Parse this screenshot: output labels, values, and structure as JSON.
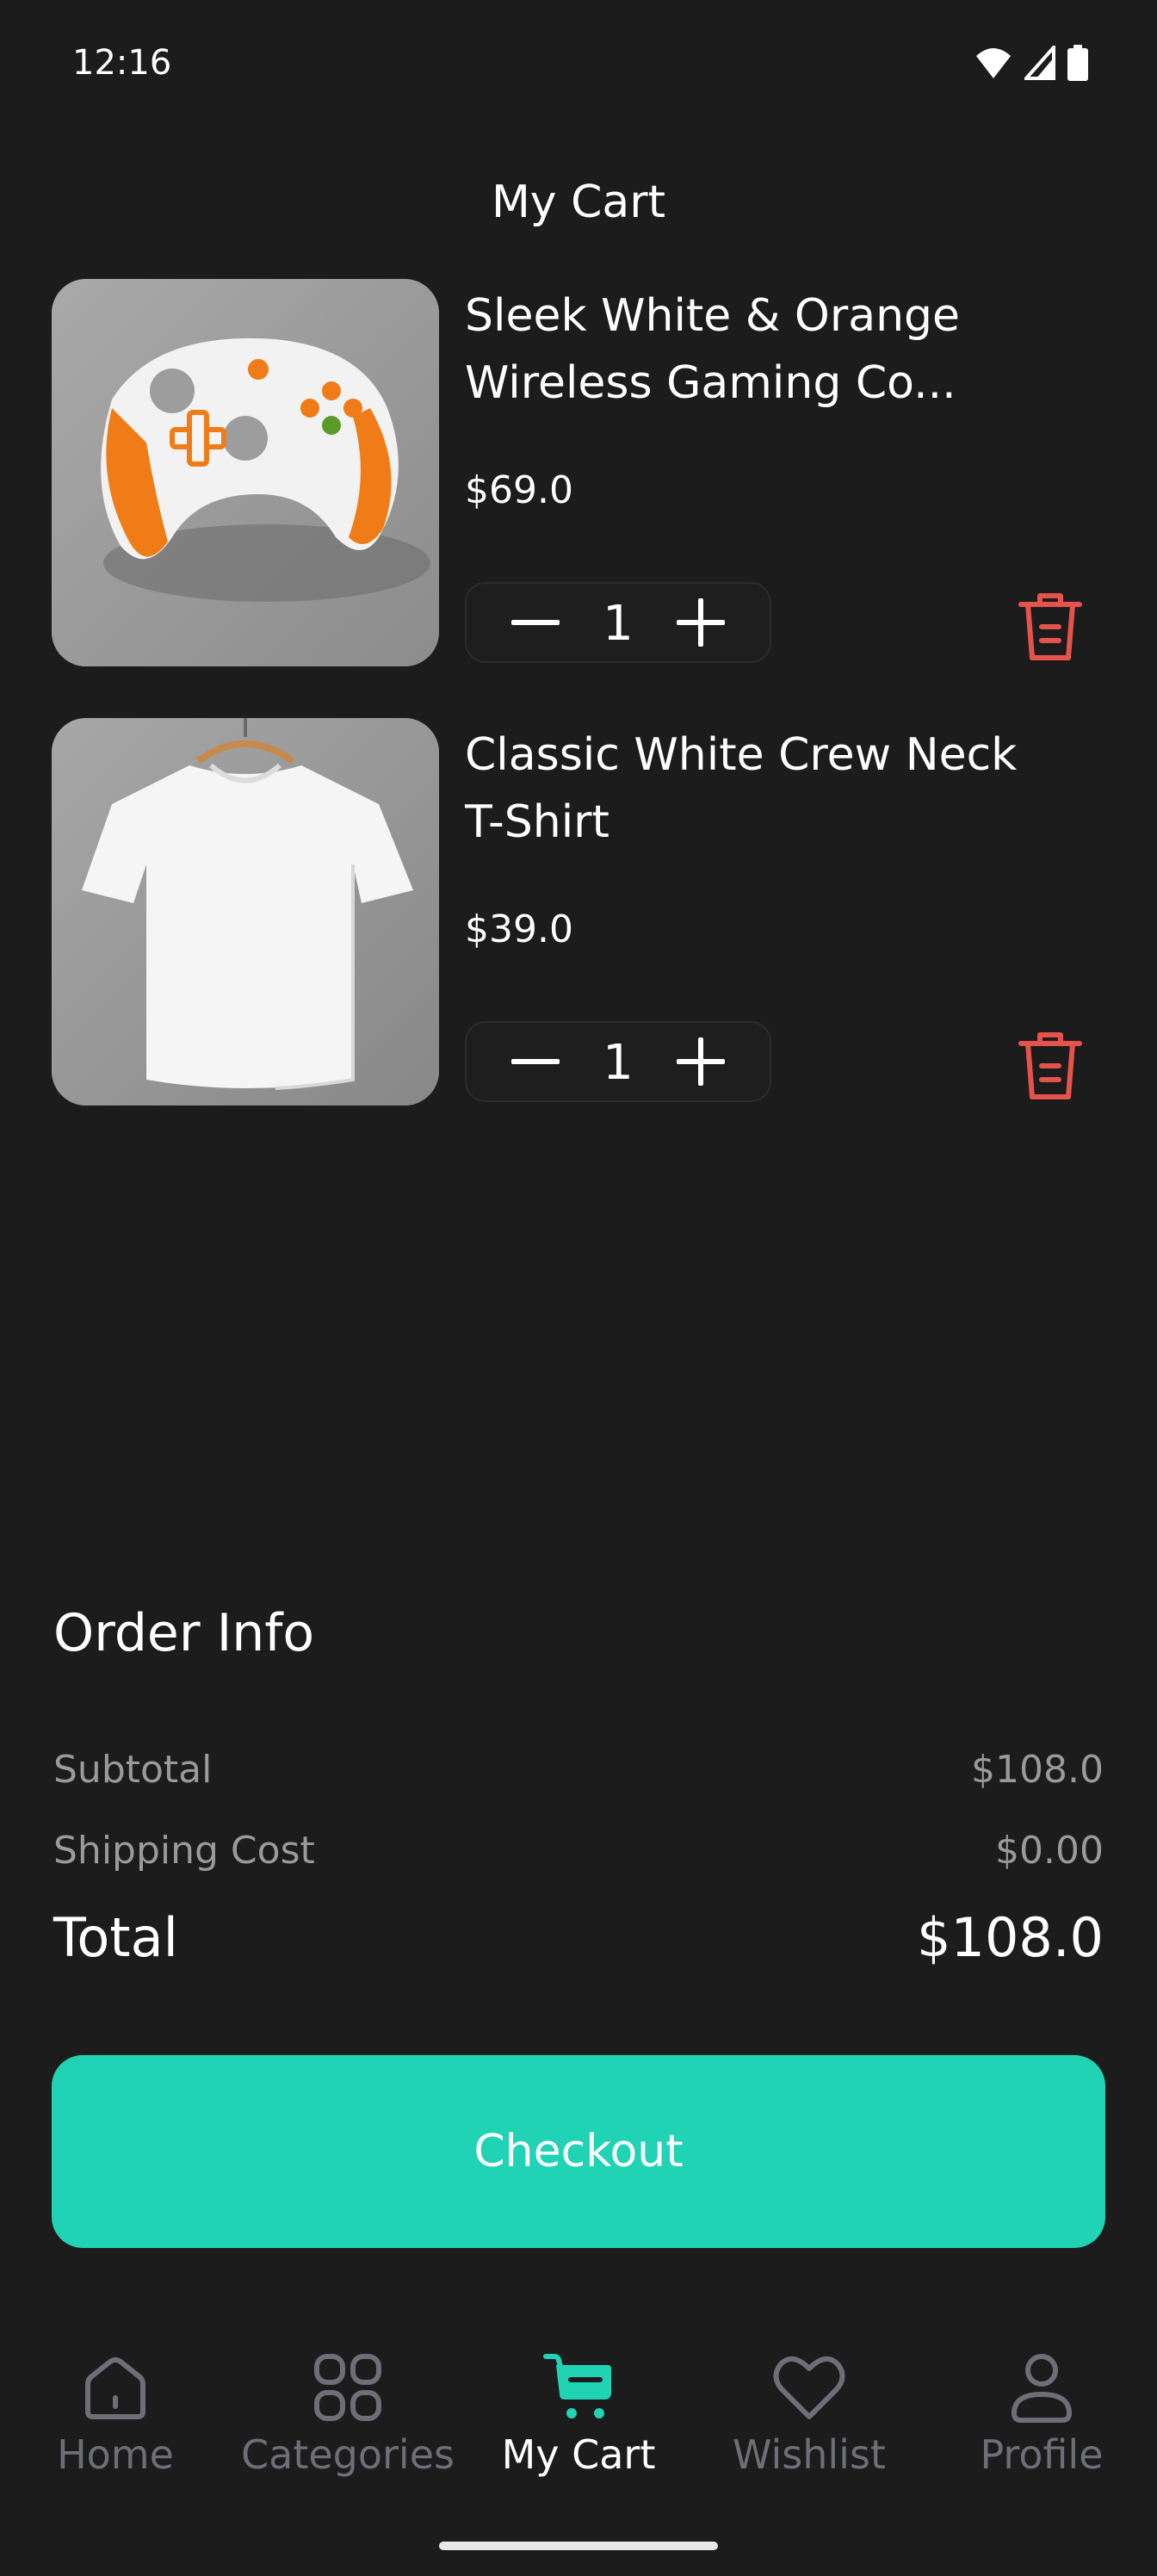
{
  "status_bar": {
    "time": "12:16"
  },
  "header": {
    "title": "My Cart"
  },
  "cart": {
    "items": [
      {
        "name": "Sleek White & Orange Wireless Gaming Co...",
        "price": "$69.0",
        "quantity": "1",
        "image_icon": "gaming-controller-image"
      },
      {
        "name": "Classic White Crew Neck T-Shirt",
        "price": "$39.0",
        "quantity": "1",
        "image_icon": "tshirt-image"
      }
    ]
  },
  "order_info": {
    "title": "Order Info",
    "subtotal_label": "Subtotal",
    "subtotal_value": "$108.0",
    "shipping_label": "Shipping Cost",
    "shipping_value": "$0.00",
    "total_label": "Total",
    "total_value": "$108.0"
  },
  "checkout": {
    "label": "Checkout",
    "color": "#20d3b5"
  },
  "nav": {
    "items": [
      {
        "label": "Home",
        "icon": "home-icon"
      },
      {
        "label": "Categories",
        "icon": "grid-icon"
      },
      {
        "label": "My Cart",
        "icon": "cart-icon",
        "active": true
      },
      {
        "label": "Wishlist",
        "icon": "heart-icon"
      },
      {
        "label": "Profile",
        "icon": "user-icon"
      }
    ]
  },
  "colors": {
    "background": "#1c1c1c",
    "accent": "#20d3b5",
    "delete": "#e5534b",
    "muted": "#9a9a9a"
  }
}
